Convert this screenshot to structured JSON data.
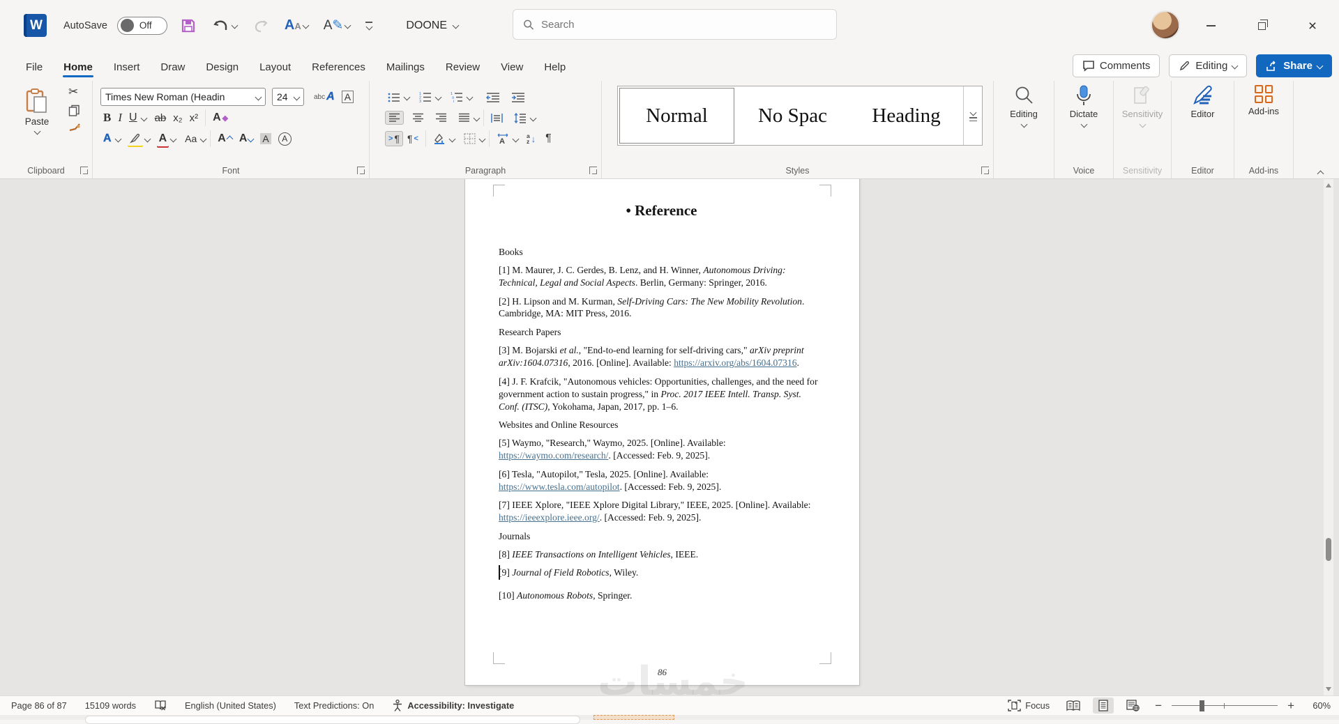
{
  "titlebar": {
    "autosave_label": "AutoSave",
    "autosave_state": "Off",
    "document_title": "DOONE",
    "search_placeholder": "Search"
  },
  "ribbon": {
    "tabs": [
      "File",
      "Home",
      "Insert",
      "Draw",
      "Design",
      "Layout",
      "References",
      "Mailings",
      "Review",
      "View",
      "Help"
    ],
    "active_tab": "Home",
    "top_right": {
      "comments": "Comments",
      "editing_mode": "Editing",
      "share": "Share"
    },
    "clipboard": {
      "paste": "Paste",
      "label": "Clipboard"
    },
    "font_group": {
      "font_name": "Times New Roman (Headin",
      "font_size": "24",
      "bold": "B",
      "italic": "I",
      "underline": "U",
      "strikethrough": "ab",
      "subscript": "x₂",
      "superscript": "x²",
      "clear_format": "A",
      "text_effects": "A",
      "highlight": "ab",
      "font_color": "A",
      "change_case": "Aa",
      "grow": "A",
      "shrink": "A",
      "char_shading": "A",
      "enclose": "A",
      "phonetic": "abc",
      "char_border": "A",
      "label": "Font"
    },
    "paragraph_group": {
      "pilcrow": "¶",
      "ltr": "¶",
      "rtl": "¶",
      "sort_a": "a",
      "sort_z": "z",
      "label": "Paragraph"
    },
    "styles_gallery": [
      "Normal",
      "No Spac",
      "Heading"
    ],
    "styles_label": "Styles",
    "buttons": {
      "editing": "Editing",
      "dictate": "Dictate",
      "sensitivity": "Sensitivity",
      "editor": "Editor",
      "addins": "Add-ins"
    },
    "group_labels": {
      "voice": "Voice",
      "sensitivity": "Sensitivity",
      "editor": "Editor",
      "addins": "Add-ins"
    }
  },
  "document": {
    "heading_bullet": "•",
    "heading": "Reference",
    "paragraphs": [
      {
        "runs": [
          {
            "t": "Books"
          }
        ]
      },
      {
        "runs": [
          {
            "t": "[1] M. Maurer, J. C. Gerdes, B. Lenz, and H. Winner, "
          },
          {
            "t": "Autonomous Driving: Technical, Legal and Social Aspects",
            "i": true
          },
          {
            "t": ". Berlin, Germany: Springer, 2016."
          }
        ]
      },
      {
        "runs": [
          {
            "t": "[2] H. Lipson and M. Kurman, "
          },
          {
            "t": "Self-Driving Cars: The New Mobility Revolution",
            "i": true
          },
          {
            "t": ". Cambridge, MA: MIT Press, 2016."
          }
        ]
      },
      {
        "runs": [
          {
            "t": "Research Papers"
          }
        ]
      },
      {
        "runs": [
          {
            "t": "[3] M. Bojarski "
          },
          {
            "t": "et al.",
            "i": true
          },
          {
            "t": ", \"End-to-end learning for self-driving cars,\" "
          },
          {
            "t": "arXiv preprint arXiv:1604.07316",
            "i": true
          },
          {
            "t": ", 2016. [Online]. Available: "
          },
          {
            "t": "https://arxiv.org/abs/1604.07316",
            "link": true
          },
          {
            "t": "."
          }
        ]
      },
      {
        "runs": [
          {
            "t": "[4] J. F. Krafcik, \"Autonomous vehicles: Opportunities, challenges, and the need for government action to sustain progress,\" in "
          },
          {
            "t": "Proc. 2017 IEEE Intell. Transp. Syst. Conf. (ITSC)",
            "i": true
          },
          {
            "t": ", Yokohama, Japan, 2017, pp. 1–6."
          }
        ]
      },
      {
        "runs": [
          {
            "t": "Websites and Online Resources"
          }
        ]
      },
      {
        "runs": [
          {
            "t": "[5] Waymo, \"Research,\" Waymo, 2025. [Online]. Available: "
          },
          {
            "t": "https://waymo.com/research/",
            "link": true
          },
          {
            "t": ". [Accessed: Feb. 9, 2025]."
          }
        ]
      },
      {
        "runs": [
          {
            "t": "[6] Tesla, \"Autopilot,\" Tesla, 2025. [Online]. Available: "
          },
          {
            "t": "https://www.tesla.com/autopilot",
            "link": true
          },
          {
            "t": ". [Accessed: Feb. 9, 2025]."
          }
        ]
      },
      {
        "runs": [
          {
            "t": "[7] IEEE Xplore, \"IEEE Xplore Digital Library,\" IEEE, 2025. [Online]. Available: "
          },
          {
            "t": "https://ieeexplore.ieee.org/",
            "link": true
          },
          {
            "t": ". [Accessed: Feb. 9, 2025]."
          }
        ]
      },
      {
        "runs": [
          {
            "t": "Journals"
          }
        ]
      },
      {
        "runs": [
          {
            "t": "[8] "
          },
          {
            "t": "IEEE Transactions on Intelligent Vehicles",
            "i": true
          },
          {
            "t": ", IEEE."
          }
        ]
      },
      {
        "runs": [
          {
            "t": "[9] "
          },
          {
            "t": "Journal of Field Robotics",
            "i": true
          },
          {
            "t": ", Wiley."
          }
        ]
      },
      {
        "extra_space": true,
        "runs": [
          {
            "t": "[10] "
          },
          {
            "t": "Autonomous Robots",
            "i": true
          },
          {
            "t": ", Springer."
          }
        ]
      }
    ],
    "page_number": "86",
    "watermark": "خمسات"
  },
  "statusbar": {
    "page_info": "Page 86 of 87",
    "word_count": "15109 words",
    "language": "English (United States)",
    "text_predictions": "Text Predictions: On",
    "accessibility": "Accessibility: Investigate",
    "focus": "Focus",
    "zoom": "60%"
  },
  "colors": {
    "accent_blue": "#1168c1",
    "share_blue": "#1267bf",
    "hyperlink": "#47708e",
    "save_purple": "#b55fc8",
    "addins_orange": "#d8671d",
    "dictate_blue": "#4b92e0"
  }
}
